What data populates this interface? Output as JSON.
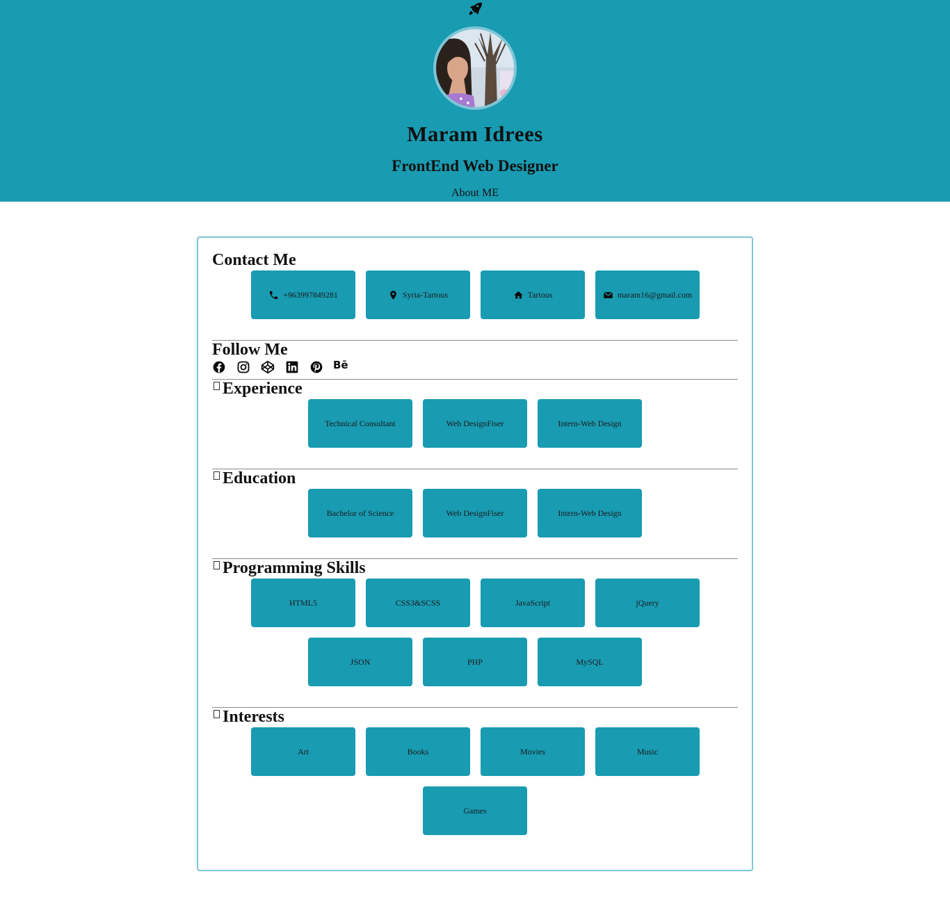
{
  "header": {
    "name": "Maram Idrees",
    "role": "FrontEnd Web Designer",
    "about_label": "About ME",
    "background_color": "#199bb2"
  },
  "contact": {
    "title": "Contact Me",
    "phone": "+963997849281",
    "location": "Syria-Tartous",
    "home": "Tartous",
    "email": "maram16@gmail.com"
  },
  "follow": {
    "title": "Follow Me",
    "icons": [
      "facebook-icon",
      "instagram-icon",
      "codepen-icon",
      "linkedin-icon",
      "pinterest-icon",
      "behance-icon"
    ],
    "behance_text": "Bē"
  },
  "experience": {
    "title": "Experience",
    "items": [
      "Technical Consultant",
      "Web DesignFiser",
      "Intern-Web Design"
    ]
  },
  "education": {
    "title": "Education",
    "items": [
      "Bachelor of Science",
      "Web DesignFiser",
      "Intern-Web Design"
    ]
  },
  "skills": {
    "title": "Programming Skills",
    "items": [
      "HTML5",
      "CSS3&SCSS",
      "JavaScript",
      "jQuery",
      "JSON",
      "PHP",
      "MySQL"
    ]
  },
  "interests": {
    "title": "Interests",
    "items": [
      "Art",
      "Books",
      "Movies",
      "Music",
      "Games"
    ]
  }
}
